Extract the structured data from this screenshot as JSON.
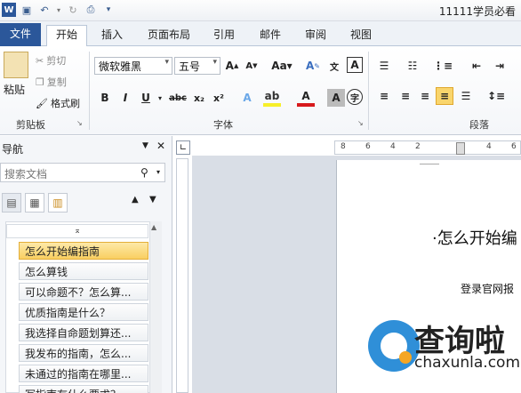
{
  "window": {
    "title": "11111学员必看"
  },
  "quick_access": {
    "undo_sep": "▾"
  },
  "tabs": [
    {
      "label": "文件"
    },
    {
      "label": "开始"
    },
    {
      "label": "插入"
    },
    {
      "label": "页面布局"
    },
    {
      "label": "引用"
    },
    {
      "label": "邮件"
    },
    {
      "label": "审阅"
    },
    {
      "label": "视图"
    }
  ],
  "clipboard": {
    "paste_label": "粘贴",
    "cut_label": "剪切",
    "copy_label": "复制",
    "format_painter_label": "格式刷",
    "group_label": "剪贴板"
  },
  "font": {
    "font_name": "微软雅黑",
    "font_size": "五号",
    "group_label": "字体"
  },
  "paragraph": {
    "group_label": "段落"
  },
  "nav": {
    "title": "导航",
    "search_placeholder": "搜索文档",
    "items": [
      {
        "label": "怎么开始编指南"
      },
      {
        "label": "怎么算钱"
      },
      {
        "label": "可以命题不？怎么算..."
      },
      {
        "label": "优质指南是什么？"
      },
      {
        "label": "我选择自命题划算还..."
      },
      {
        "label": "我发布的指南，怎么..."
      },
      {
        "label": "未通过的指南在哪里..."
      },
      {
        "label": "写指南有什么要求？"
      }
    ]
  },
  "ruler": {
    "numbers": [
      "8",
      "6",
      "4",
      "2",
      "2",
      "4",
      "6"
    ]
  },
  "document": {
    "heading": "·怎么开始编",
    "line2": "登录官网报"
  },
  "watermark": {
    "text": "查询啦",
    "url": "chaxunla.com"
  }
}
